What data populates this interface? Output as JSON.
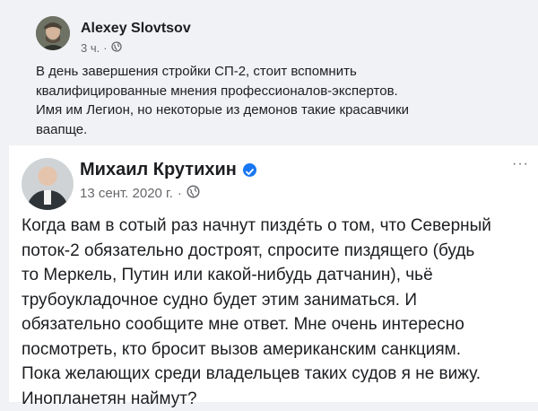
{
  "post1": {
    "author": "Alexey Slovtsov",
    "time": "3 ч.",
    "separator": "·",
    "lines": [
      "В день завершения стройки СП-2, стоит вспомнить",
      "квалифицированные мнения профессионалов-экспертов.",
      "Имя им Легион, но некоторые из демонов такие красавчики",
      "ваапще."
    ]
  },
  "post2": {
    "author": "Михаил Крутихин",
    "date": "13 сент. 2020 г.",
    "separator": "·",
    "more": "···",
    "lines": [
      "Когда вам в сотый раз начнут пиздéть о том, что Северный",
      "поток-2 обязательно достроят, спросите пиздящего (будь",
      "то Меркель, Путин или какой-нибудь датчанин), чьё",
      "трубоукладочное судно будет этим заниматься. И",
      "обязательно сообщите мне ответ. Мне очень интересно",
      "посмотреть, кто бросит вызов американским санкциям.",
      "Пока желающих среди владельцев таких судов я не вижу.",
      "Инопланетян наймут?"
    ]
  },
  "colors": {
    "background": "#f0f2f5",
    "card": "#ffffff",
    "text": "#1c1e21",
    "secondary": "#65676b",
    "verified": "#1877f2"
  },
  "icons": [
    "globe-icon",
    "verified-badge-icon",
    "more-options-icon"
  ]
}
